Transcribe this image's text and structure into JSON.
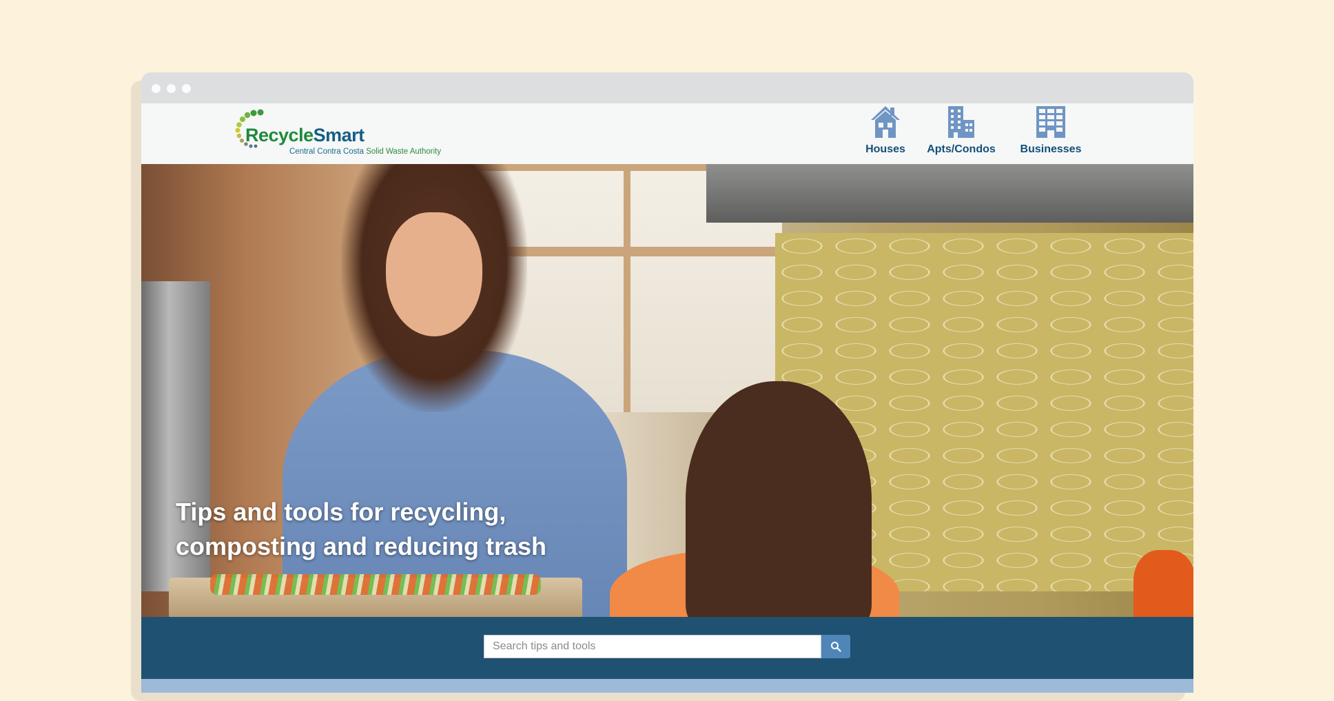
{
  "browser": {
    "dots": [
      "window-dot-close",
      "window-dot-minimize",
      "window-dot-zoom"
    ]
  },
  "logo": {
    "title_part1": "Recycle",
    "title_part2": "Smart",
    "subtitle_part1": "Central Contra Costa ",
    "subtitle_part2": "Solid Waste Authority"
  },
  "nav": {
    "items": [
      {
        "label": "Houses",
        "icon": "house-icon"
      },
      {
        "label": "Apts/Condos",
        "icon": "apartment-building-icon"
      },
      {
        "label": "Businesses",
        "icon": "office-building-icon"
      }
    ]
  },
  "hero": {
    "headline_line1": "Tips and tools for recycling,",
    "headline_line2": "composting and reducing trash"
  },
  "search": {
    "placeholder": "Search tips and tools",
    "value": "",
    "button_icon": "search-icon"
  },
  "colors": {
    "nav_blue": "#12507a",
    "icon_blue": "#6f95c4",
    "search_band": "#0e4468",
    "search_button": "#4f86b8",
    "logo_green": "#1f8a3b",
    "logo_blue": "#145f86"
  }
}
